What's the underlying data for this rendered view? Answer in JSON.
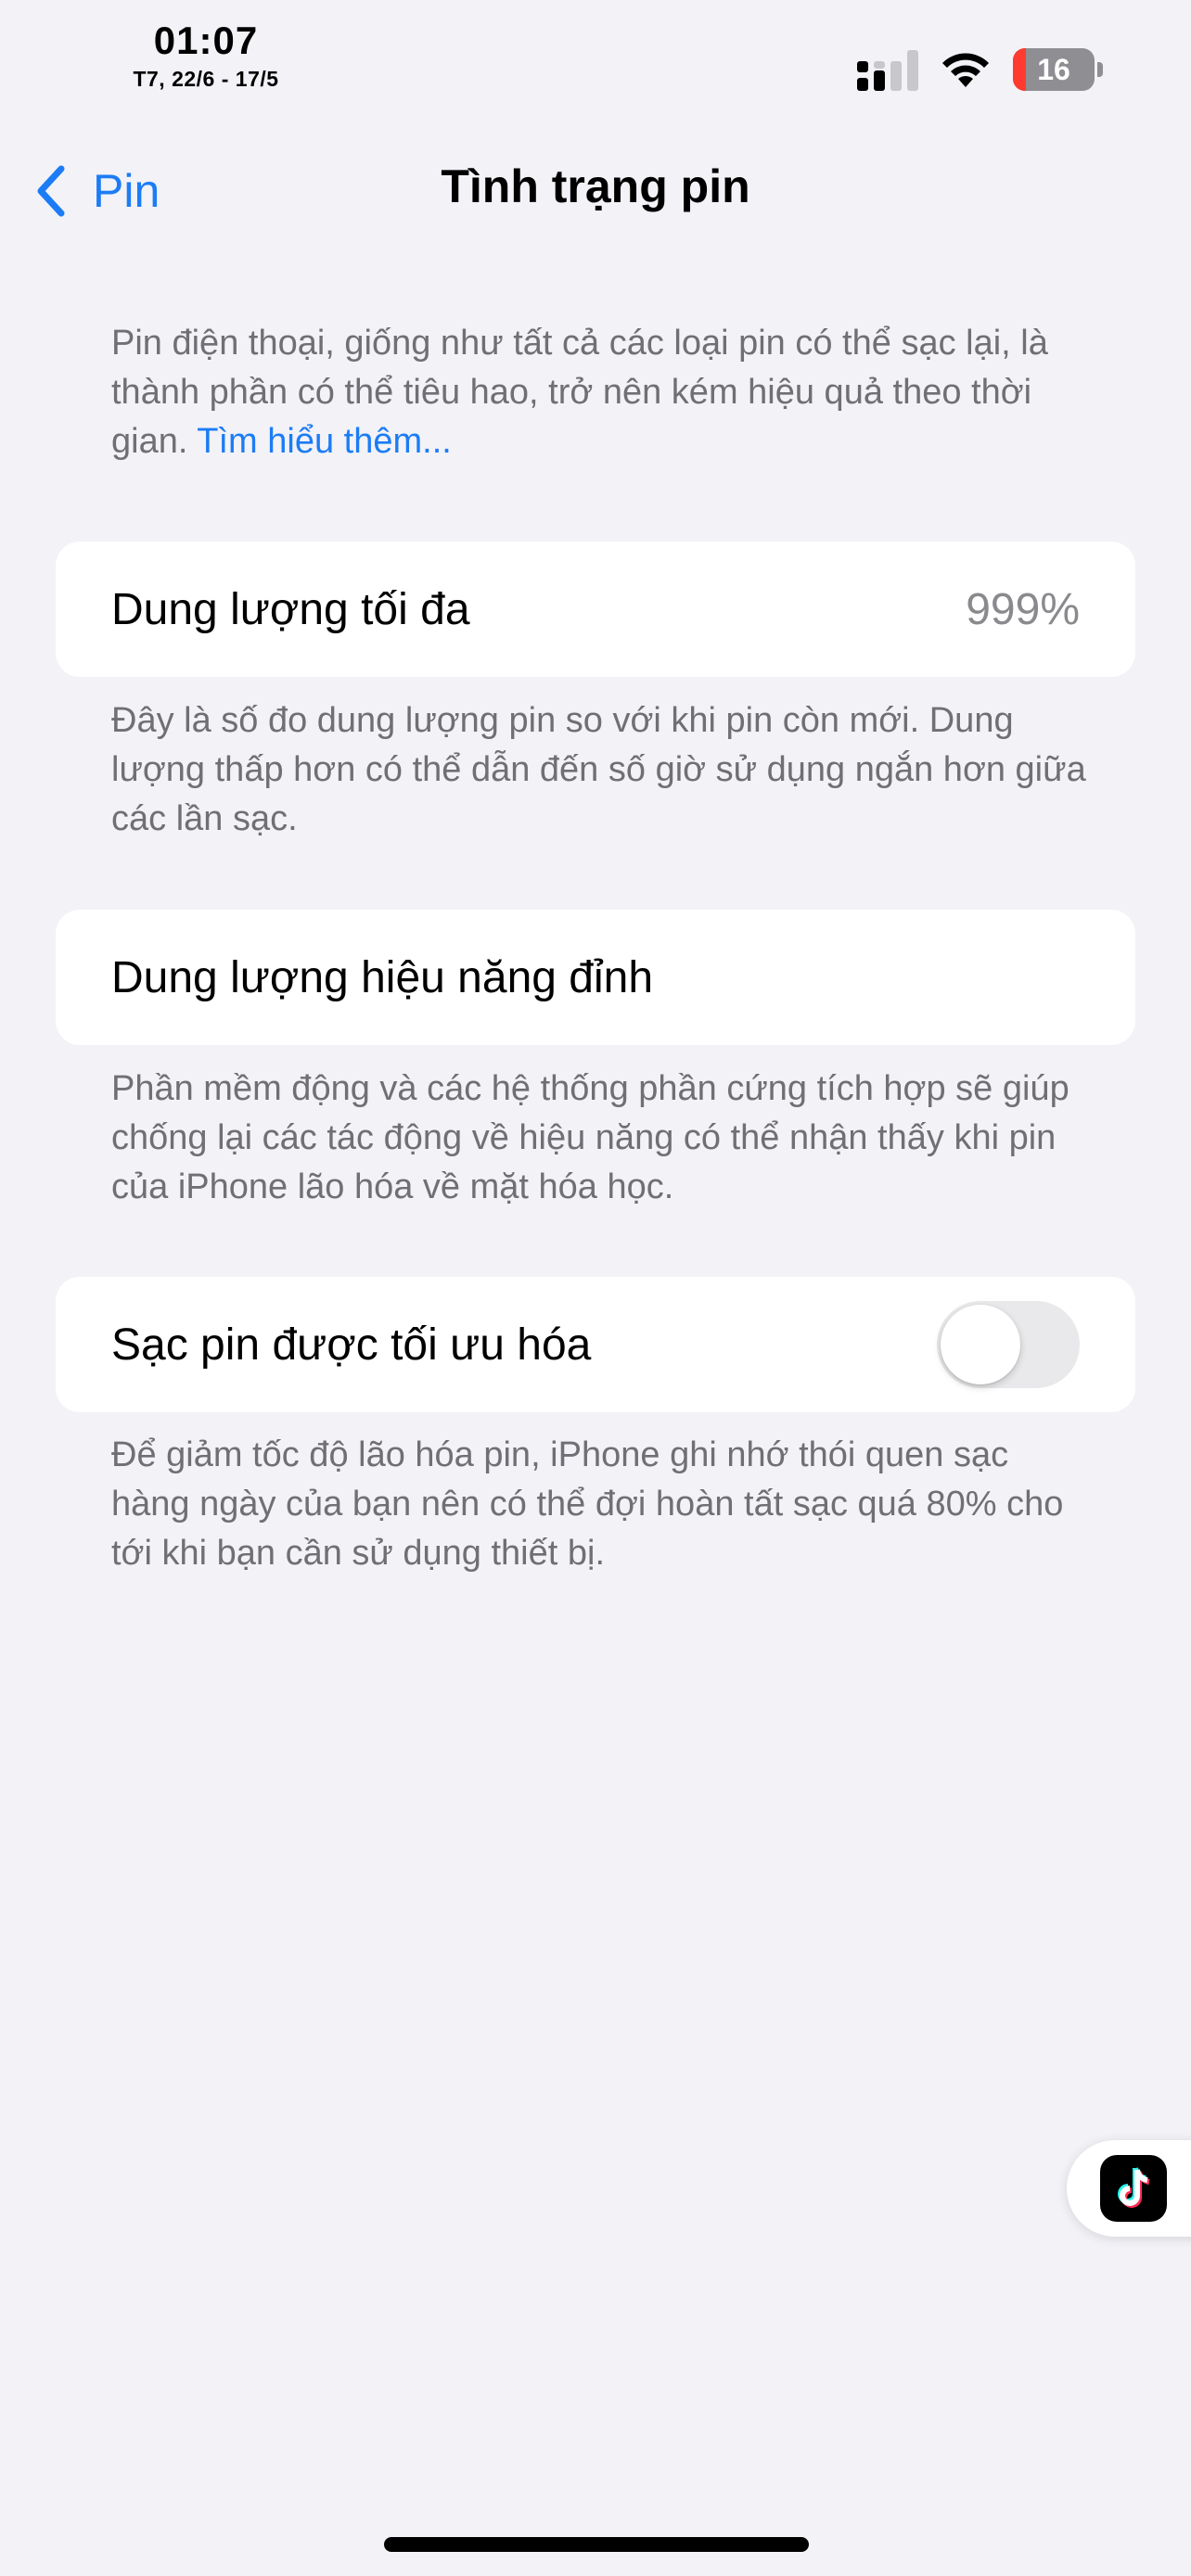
{
  "status_bar": {
    "time": "01:07",
    "date": "T7, 22/6 - 17/5",
    "battery_level": "16",
    "battery_fraction": 0.16,
    "battery_color": "#ff3b30"
  },
  "nav": {
    "back_label": "Pin",
    "title": "Tình trạng pin"
  },
  "intro": {
    "text": "Pin điện thoại, giống như tất cả các loại pin có thể sạc lại, là thành phần có thể tiêu hao, trở nên kém hiệu quả theo thời gian. ",
    "link": "Tìm hiểu thêm..."
  },
  "max_capacity": {
    "label": "Dung lượng tối đa",
    "value": "999%",
    "description": "Đây là số đo dung lượng pin so với khi pin còn mới. Dung lượng thấp hơn có thể dẫn đến số giờ sử dụng ngắn hơn giữa các lần sạc."
  },
  "peak_performance": {
    "label": "Dung lượng hiệu năng đỉnh",
    "description": "Phần mềm động và các hệ thống phần cứng tích hợp sẽ giúp chống lại các tác động về hiệu năng có thể nhận thấy khi pin của iPhone lão hóa về mặt hóa học."
  },
  "optimized_charging": {
    "label": "Sạc pin được tối ưu hóa",
    "enabled": false,
    "description": "Để giảm tốc độ lão hóa pin, iPhone ghi nhớ thói quen sạc hàng ngày của bạn nên có thể đợi hoàn tất sạc quá 80% cho tới khi bạn cần sử dụng thiết bị."
  },
  "colors": {
    "accent": "#1c7cf5",
    "background": "#f2f2f7"
  },
  "icons": {
    "back": "chevron-left-icon",
    "signal": "cellular-signal-icon",
    "wifi": "wifi-icon",
    "battery": "battery-icon",
    "floating": "tiktok-icon"
  }
}
